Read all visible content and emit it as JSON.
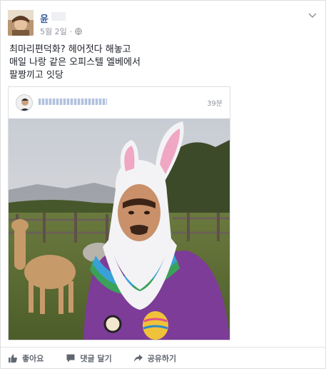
{
  "post": {
    "author": "윤",
    "date": "5월 2일",
    "privacy_icon": "globe-icon",
    "menu_icon": "chevron-down-icon",
    "text_lines": [
      "최마리편덕화? 헤어젓다 해놓고",
      "매일 나랑 같은 오피스텔 엘베에서",
      "팔짱끼고 잇당"
    ]
  },
  "shared": {
    "time": "39분"
  },
  "actions": [
    {
      "label": "좋아요",
      "icon": "thumbs-up-icon"
    },
    {
      "label": "댓글 달기",
      "icon": "comment-icon"
    },
    {
      "label": "공유하기",
      "icon": "share-icon"
    }
  ],
  "colors": {
    "link": "#365899",
    "muted": "#90949c",
    "action": "#616770"
  }
}
